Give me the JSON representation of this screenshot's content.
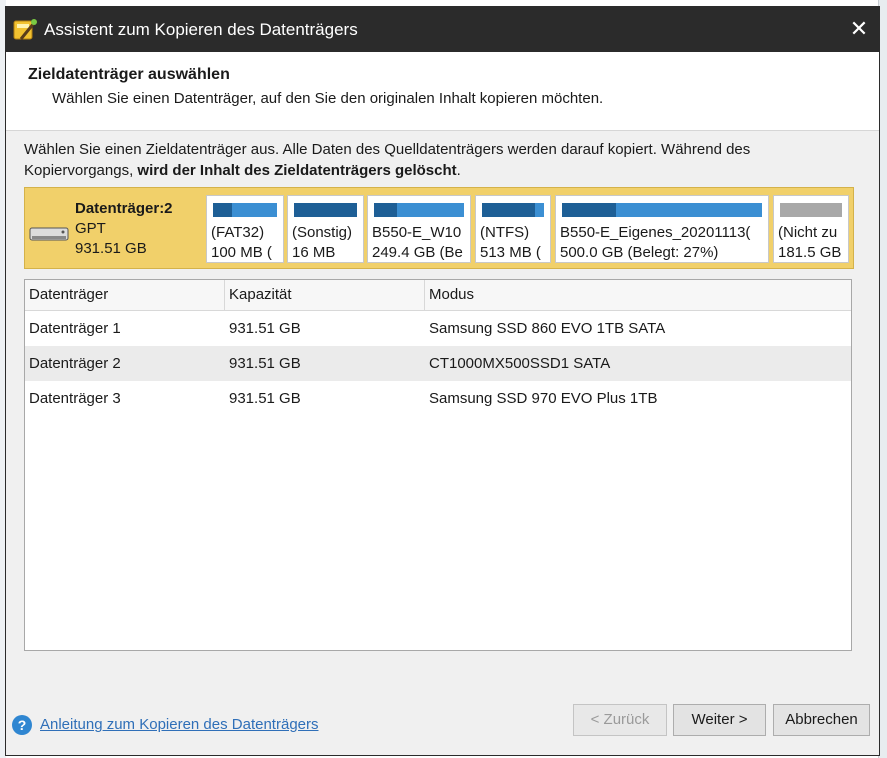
{
  "window": {
    "title": "Assistent zum Kopieren des Datenträgers"
  },
  "header": {
    "title": "Zieldatenträger auswählen",
    "subtitle": "Wählen Sie einen Datenträger, auf den Sie den originalen Inhalt kopieren möchten."
  },
  "instruction": {
    "line1": "Wählen Sie einen Zieldatenträger aus. Alle Daten des Quelldatenträgers werden darauf kopiert. Während des",
    "line2_prefix": "Kopiervorgangs, ",
    "line2_bold": "wird der Inhalt des Zieldatenträgers gelöscht",
    "line2_suffix": "."
  },
  "disk_map": {
    "name": "Datenträger:2",
    "type": "GPT",
    "size": "931.51 GB",
    "partitions": [
      {
        "line1": "(FAT32)",
        "line2": "100 MB (",
        "used_fraction": 0.3,
        "color": "#3b8fd3"
      },
      {
        "line1": "(Sonstig)",
        "line2": "16 MB",
        "used_fraction": 1.0,
        "color": "#3b8fd3"
      },
      {
        "line1": "B550-E_W10",
        "line2": "249.4 GB (Be",
        "used_fraction": 0.25,
        "color": "#3b8fd3"
      },
      {
        "line1": "(NTFS)",
        "line2": "513 MB (",
        "used_fraction": 0.85,
        "color": "#3b8fd3"
      },
      {
        "line1": "B550-E_Eigenes_20201113(",
        "line2": "500.0 GB (Belegt: 27%)",
        "used_fraction": 0.27,
        "color": "#3b8fd3"
      },
      {
        "line1": "(Nicht zu",
        "line2": "181.5 GB",
        "used_fraction": 0,
        "color": "#a8a8a8"
      }
    ]
  },
  "table": {
    "columns": [
      "Datenträger",
      "Kapazität",
      "Modus"
    ],
    "rows": [
      {
        "disk": "Datenträger 1",
        "capacity": "931.51 GB",
        "mode": "Samsung SSD 860 EVO 1TB SATA"
      },
      {
        "disk": "Datenträger 2",
        "capacity": "931.51 GB",
        "mode": "CT1000MX500SSD1 SATA"
      },
      {
        "disk": "Datenträger 3",
        "capacity": "931.51 GB",
        "mode": "Samsung SSD 970 EVO Plus 1TB"
      }
    ],
    "selected_index": 1
  },
  "footer": {
    "help_icon": "question-icon",
    "help_link": "Anleitung zum Kopieren des Datenträgers",
    "back_label": "< Zurück",
    "next_label": "Weiter >",
    "cancel_label": "Abbrechen"
  }
}
